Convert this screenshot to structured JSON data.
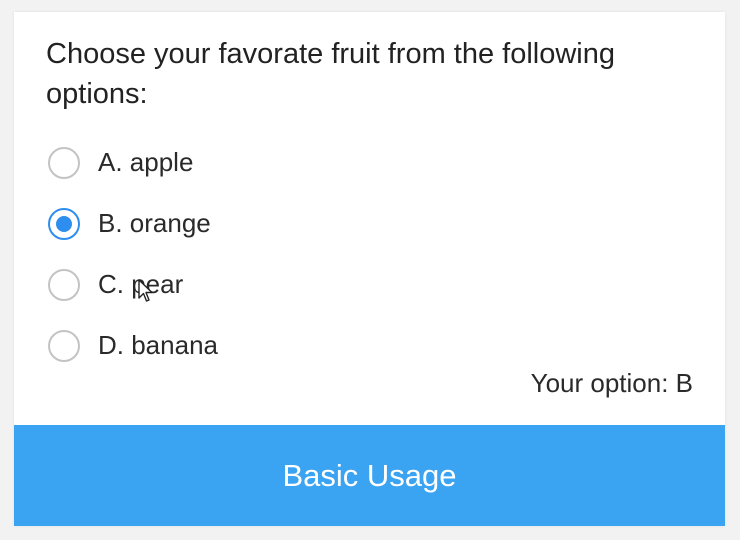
{
  "question": "Choose your favorate fruit from the following options:",
  "options": [
    {
      "label": "A. apple",
      "checked": false
    },
    {
      "label": "B. orange",
      "checked": true
    },
    {
      "label": "C. pear",
      "checked": false
    },
    {
      "label": "D. banana",
      "checked": false
    }
  ],
  "result": "Your option: B",
  "footer": {
    "label": "Basic Usage"
  },
  "colors": {
    "accent": "#2d8ef0",
    "footer": "#3aa3f2",
    "radio_border": "#c3c3c3"
  },
  "icons": {
    "cursor": "mouse-pointer-icon"
  }
}
